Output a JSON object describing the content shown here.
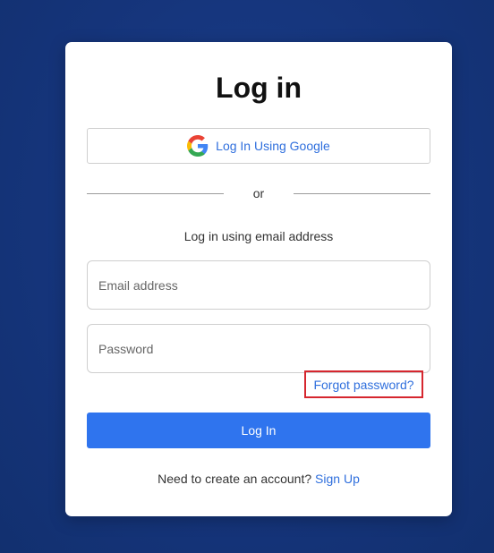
{
  "login": {
    "title": "Log in",
    "google_button_label": "Log In Using Google",
    "divider_text": "or",
    "email_hint": "Log in using email address",
    "email_placeholder": "Email address",
    "password_placeholder": "Password",
    "forgot_password": "Forgot password?",
    "submit_label": "Log In",
    "signup_prompt": "Need to create an account?",
    "signup_link": "Sign Up"
  },
  "colors": {
    "background": "#16347a",
    "primary": "#2f74ee",
    "link": "#2f6fdd",
    "highlight_border": "#d6262e"
  },
  "icons": {
    "google": "google-icon"
  }
}
